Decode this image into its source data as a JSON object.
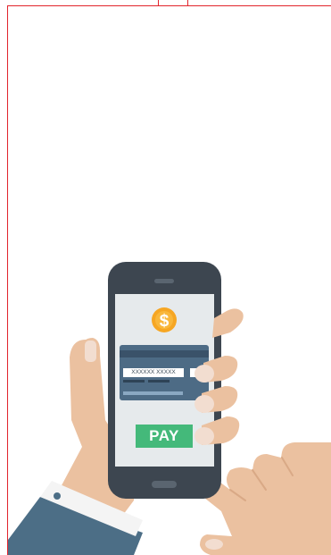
{
  "payment": {
    "card_number_mask": "XXXXXX XXXXX",
    "pay_label": "PAY",
    "currency_symbol": "$"
  },
  "colors": {
    "frame_red": "#e2242c",
    "phone_body": "#3d4650",
    "screen_bg": "#e6eaec",
    "coin": "#f6a623",
    "card": "#4d6b85",
    "pay_button": "#44b97a",
    "skin": "#ebc1a0",
    "sleeve": "#4c6e86"
  }
}
